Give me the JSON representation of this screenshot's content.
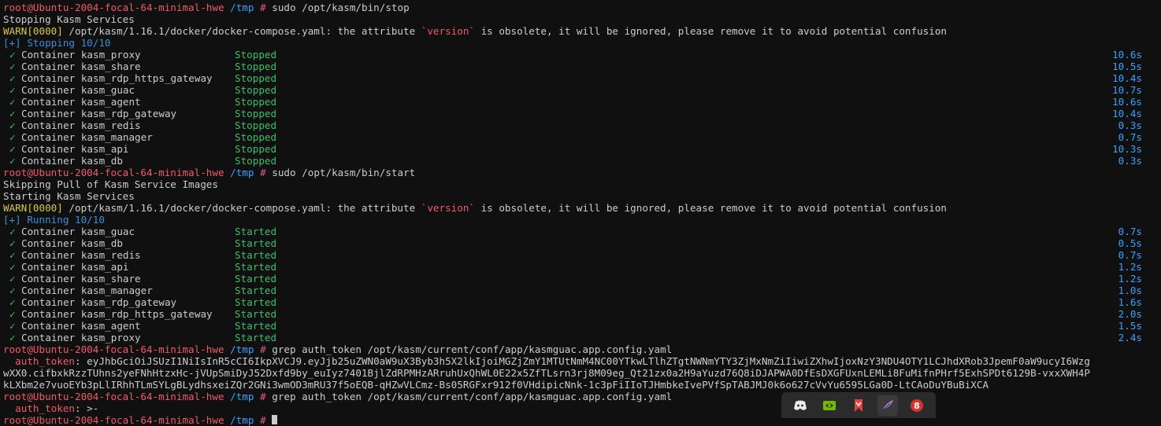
{
  "prompt": {
    "user_host": "root@Ubuntu-2004-focal-64-minimal-hwe",
    "dir": "/tmp",
    "symbol": "#"
  },
  "commands": {
    "stop": "sudo /opt/kasm/bin/stop",
    "start": "sudo /opt/kasm/bin/start",
    "grep1": "grep auth_token /opt/kasm/current/conf/app/kasmguac.app.config.yaml",
    "grep2": "grep auth_token /opt/kasm/current/conf/app/kasmguac.app.config.yaml"
  },
  "stop_section": {
    "header": "Stopping Kasm Services",
    "warn_prefix": "WARN[0000]",
    "warn_text_a": " /opt/kasm/1.16.1/docker/docker-compose.yaml: the attribute ",
    "warn_attr": "`version`",
    "warn_text_b": " is obsolete, it will be ignored, please remove it to avoid potential confusion",
    "progress": "[+] Stopping 10/10",
    "containers": [
      {
        "name": "Container kasm_proxy",
        "status": "Stopped",
        "time": "10.6s"
      },
      {
        "name": "Container kasm_share",
        "status": "Stopped",
        "time": "10.5s"
      },
      {
        "name": "Container kasm_rdp_https_gateway",
        "status": "Stopped",
        "time": "10.4s"
      },
      {
        "name": "Container kasm_guac",
        "status": "Stopped",
        "time": "10.7s"
      },
      {
        "name": "Container kasm_agent",
        "status": "Stopped",
        "time": "10.6s"
      },
      {
        "name": "Container kasm_rdp_gateway",
        "status": "Stopped",
        "time": "10.4s"
      },
      {
        "name": "Container kasm_redis",
        "status": "Stopped",
        "time": "0.3s"
      },
      {
        "name": "Container kasm_manager",
        "status": "Stopped",
        "time": "0.7s"
      },
      {
        "name": "Container kasm_api",
        "status": "Stopped",
        "time": "10.3s"
      },
      {
        "name": "Container kasm_db",
        "status": "Stopped",
        "time": "0.3s"
      }
    ]
  },
  "start_section": {
    "skip": "Skipping Pull of Kasm Service Images",
    "header": "Starting Kasm Services",
    "warn_prefix": "WARN[0000]",
    "warn_text_a": " /opt/kasm/1.16.1/docker/docker-compose.yaml: the attribute ",
    "warn_attr": "`version`",
    "warn_text_b": " is obsolete, it will be ignored, please remove it to avoid potential confusion",
    "progress": "[+] Running 10/10",
    "containers": [
      {
        "name": "Container kasm_guac",
        "status": "Started",
        "time": "0.7s"
      },
      {
        "name": "Container kasm_db",
        "status": "Started",
        "time": "0.5s"
      },
      {
        "name": "Container kasm_redis",
        "status": "Started",
        "time": "0.7s"
      },
      {
        "name": "Container kasm_api",
        "status": "Started",
        "time": "1.2s"
      },
      {
        "name": "Container kasm_share",
        "status": "Started",
        "time": "1.2s"
      },
      {
        "name": "Container kasm_manager",
        "status": "Started",
        "time": "1.0s"
      },
      {
        "name": "Container kasm_rdp_gateway",
        "status": "Started",
        "time": "1.6s"
      },
      {
        "name": "Container kasm_rdp_https_gateway",
        "status": "Started",
        "time": "2.0s"
      },
      {
        "name": "Container kasm_agent",
        "status": "Started",
        "time": "1.5s"
      },
      {
        "name": "Container kasm_proxy",
        "status": "Started",
        "time": "2.4s"
      }
    ]
  },
  "grep_result": {
    "key": "  auth_token",
    "value_line1": ": eyJhbGciOiJSUzI1NiIsInR5cCI6IkpXVCJ9.eyJjb25uZWN0aW9uX3Byb3h5X2lkIjoiMGZjZmY1MTUtNmM4NC00YTkwLTlhZTgtNWNmYTY3ZjMxNmZiIiwiZXhwIjoxNzY3NDU4OTY1LCJhdXRob3JpemF0aW9ucyI6Wzg",
    "value_line2": "wXX0.cifbxkRzzTUhns2yeFNhHtzxHc-jVUpSmiDyJ52Dxfd9by_euIyz7401BjlZdRPMHzARruhUxQhWL0E22x5ZfTLsrn3rj8M09eg_Qt21zx0a2H9aYuzd76Q8iDJAPWA0DfEsDXGFUxnLEMLi8FuMifnPHrf5ExhSPDt6129B-vxxXWH4P",
    "value_line3": "kLXbm2e7vuoEYb3pLlIRhhTLmSYLgBLydhsxeiZQr2GNi3wmOD3mRU37f5oEQB-qHZwVLCmz-Bs05RGFxr912f0VHdipicNnk-1c3pFiIIoTJHmbkeIvePVfSpTABJMJ0k6o627cVvYu6595LGa0D-LtCAoDuYBuBiXCA"
  },
  "last_output": {
    "key": "  auth_token",
    "value": ": >-"
  },
  "check_glyph": "✓",
  "taskbar": {
    "icons": [
      "discord-icon",
      "nvidia-icon",
      "bookmark-icon",
      "feather-icon",
      "app-8-icon"
    ]
  }
}
